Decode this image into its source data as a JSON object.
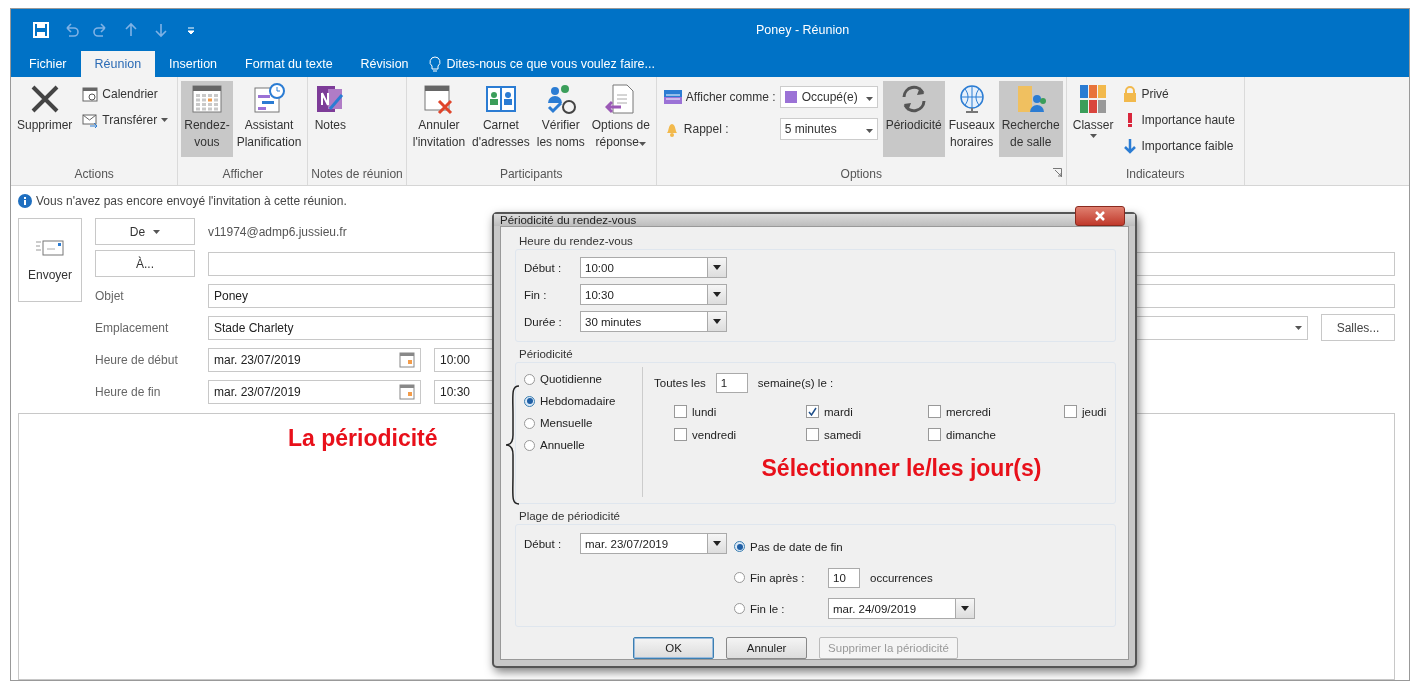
{
  "window": {
    "title": "Poney - Réunion"
  },
  "tabs": [
    {
      "label": "Fichier",
      "selected": false
    },
    {
      "label": "Réunion",
      "selected": true
    },
    {
      "label": "Insertion",
      "selected": false
    },
    {
      "label": "Format du texte",
      "selected": false
    },
    {
      "label": "Révision",
      "selected": false
    }
  ],
  "tell_me": "Dites-nous ce que vous voulez faire...",
  "ribbon": {
    "groups": [
      {
        "label": "Actions",
        "items": [
          {
            "kind": "large",
            "lines": [
              "Supprimer"
            ],
            "pressed": false,
            "dropdown": false
          },
          {
            "kind": "stack",
            "items": [
              {
                "kind": "small",
                "label": "Calendrier",
                "dropdown": false
              },
              {
                "kind": "small",
                "label": "Transférer",
                "dropdown": true
              }
            ]
          }
        ]
      },
      {
        "label": "Afficher",
        "items": [
          {
            "kind": "large",
            "lines": [
              "Rendez-",
              "vous"
            ],
            "pressed": true,
            "dropdown": false
          },
          {
            "kind": "large",
            "lines": [
              "Assistant",
              "Planification"
            ],
            "pressed": false,
            "dropdown": false
          }
        ]
      },
      {
        "label": "Notes de réunion",
        "items": [
          {
            "kind": "large",
            "lines": [
              "Notes"
            ],
            "pressed": false,
            "dropdown": false
          }
        ]
      },
      {
        "label": "Participants",
        "items": [
          {
            "kind": "large",
            "lines": [
              "Annuler",
              "l'invitation"
            ],
            "pressed": false,
            "dropdown": false
          },
          {
            "kind": "large",
            "lines": [
              "Carnet",
              "d'adresses"
            ],
            "pressed": false,
            "dropdown": false
          },
          {
            "kind": "large",
            "lines": [
              "Vérifier",
              "les noms"
            ],
            "pressed": false,
            "dropdown": false
          },
          {
            "kind": "large",
            "lines": [
              "Options de",
              "réponse"
            ],
            "pressed": false,
            "dropdown": true
          }
        ]
      },
      {
        "label": "Options",
        "items": [
          {
            "kind": "stack",
            "items": [
              {
                "kind": "select",
                "label": "Afficher comme :",
                "value": "Occupé(e)",
                "color": "#9b72d6"
              },
              {
                "kind": "select",
                "label": "Rappel :",
                "value": "5 minutes"
              }
            ]
          },
          {
            "kind": "large",
            "lines": [
              "Périodicité"
            ],
            "pressed": true,
            "dropdown": false
          },
          {
            "kind": "large",
            "lines": [
              "Fuseaux",
              "horaires"
            ],
            "pressed": false,
            "dropdown": false
          },
          {
            "kind": "large",
            "lines": [
              "Recherche",
              "de salle"
            ],
            "pressed": true,
            "dropdown": false
          }
        ]
      },
      {
        "label": "Indicateurs",
        "items": [
          {
            "kind": "large",
            "lines": [
              "Classer"
            ],
            "pressed": false,
            "dropdown": true
          },
          {
            "kind": "stack",
            "items": [
              {
                "kind": "small",
                "label": "Privé",
                "dropdown": false
              },
              {
                "kind": "small",
                "label": "Importance haute",
                "dropdown": false
              },
              {
                "kind": "small",
                "label": "Importance faible",
                "dropdown": false
              }
            ]
          }
        ]
      }
    ]
  },
  "info": "Vous n'avez pas encore envoyé l'invitation à cette réunion.",
  "send_button": "Envoyer",
  "form": {
    "from_button": "De",
    "from_value": "v11974@admp6.jussieu.fr",
    "to_button": "À...",
    "subject_label": "Objet",
    "subject": "Poney",
    "location_label": "Emplacement",
    "location": "Stade Charlety",
    "rooms_button": "Salles...",
    "start_label": "Heure de début",
    "start_date": "mar. 23/07/2019",
    "start_time": "10:00",
    "end_label": "Heure de fin",
    "end_date": "mar. 23/07/2019",
    "end_time": "10:30"
  },
  "annotations": [
    "La périodicité",
    "Sélectionner le/les jour(s)"
  ],
  "dialog": {
    "title": "Périodicité du rendez-vous",
    "time_group": {
      "title": "Heure du rendez-vous",
      "rows": [
        {
          "label": "Début :",
          "value": "10:00"
        },
        {
          "label": "Fin :",
          "value": "10:30"
        },
        {
          "label": "Durée :",
          "value": "30 minutes"
        }
      ]
    },
    "pattern_group": {
      "title": "Périodicité",
      "options": [
        {
          "label": "Quotidienne",
          "selected": false
        },
        {
          "label": "Hebdomadaire",
          "selected": true
        },
        {
          "label": "Mensuelle",
          "selected": false
        },
        {
          "label": "Annuelle",
          "selected": false
        }
      ],
      "every_label": "Toutes les",
      "every_value": "1",
      "every_unit": "semaine(s) le :",
      "days": [
        {
          "label": "lundi",
          "checked": false
        },
        {
          "label": "mardi",
          "checked": true
        },
        {
          "label": "mercredi",
          "checked": false
        },
        {
          "label": "jeudi",
          "checked": false
        },
        {
          "label": "vendredi",
          "checked": false
        },
        {
          "label": "samedi",
          "checked": false
        },
        {
          "label": "dimanche",
          "checked": false
        }
      ]
    },
    "range_group": {
      "title": "Plage de périodicité",
      "start_label": "Début :",
      "start_value": "mar. 23/07/2019",
      "options": [
        {
          "kind": "none",
          "label": "Pas de date de fin",
          "selected": true
        },
        {
          "kind": "count",
          "label": "Fin après :",
          "selected": false,
          "value": "10",
          "unit": "occurrences"
        },
        {
          "kind": "date",
          "label": "Fin le :",
          "selected": false,
          "value": "mar. 24/09/2019"
        }
      ]
    },
    "buttons": [
      {
        "label": "OK",
        "default": true,
        "disabled": false
      },
      {
        "label": "Annuler",
        "default": false,
        "disabled": false
      },
      {
        "label": "Supprimer la périodicité",
        "default": false,
        "disabled": true
      }
    ]
  }
}
